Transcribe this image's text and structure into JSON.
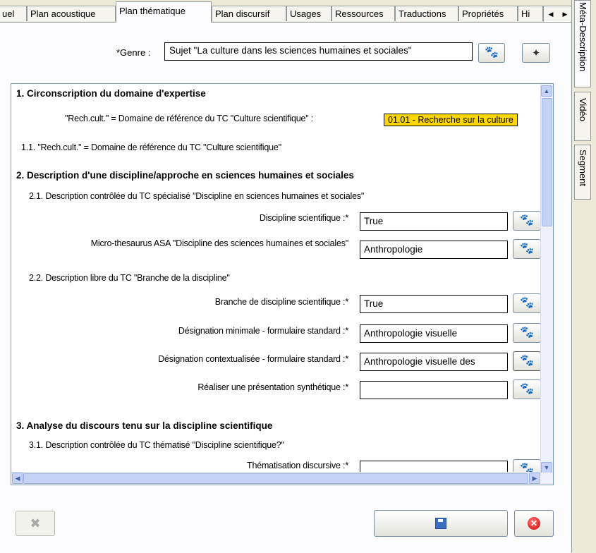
{
  "tabs": [
    {
      "label": "uel"
    },
    {
      "label": "Plan acoustique"
    },
    {
      "label": "Plan thématique",
      "active": true
    },
    {
      "label": "Plan discursif"
    },
    {
      "label": "Usages"
    },
    {
      "label": "Ressources"
    },
    {
      "label": "Traductions"
    },
    {
      "label": "Propriétés"
    },
    {
      "label": "Hi"
    }
  ],
  "side_tabs": [
    "Méta-Description",
    "Vidéo",
    "Segment"
  ],
  "genre": {
    "label": "*Genre :",
    "value": "Sujet \"La culture dans les sciences humaines et sociales\"",
    "paw_icon": "green-paw-icon",
    "wand_icon": "magic-wand-icon"
  },
  "form": {
    "s1": {
      "title": "1. Circonscription du domaine d'expertise",
      "ref_label": "\"Rech.cult.\" = Domaine de référence du TC \"Culture scientifique\" :",
      "ref_tag": "01.01 - Recherche sur la culture",
      "sub": "1.1. \"Rech.cult.\" = Domaine de référence du TC \"Culture scientifique\""
    },
    "s2": {
      "title": "2. Description d'une discipline/approche en sciences humaines et sociales",
      "sub1": "2.1. Description contrôlée du TC spécialisé \"Discipline en sciences humaines et sociales\"",
      "f1_label": "Discipline scientifique :*",
      "f1_value": "True",
      "f2_label": "Micro-thesaurus ASA \"Discipline des sciences humaines et sociales\"",
      "f2_value": "Anthropologie",
      "sub2": "2.2. Description libre du TC \"Branche de la discipline\"",
      "f3_label": "Branche de discipline scientifique :*",
      "f3_value": "True",
      "f4_label": "Désignation minimale - formulaire standard :*",
      "f4_value": "Anthropologie visuelle",
      "f5_label": "Désignation contextualisée - formulaire standard :*",
      "f5_value": "Anthropologie visuelle des",
      "f6_label": "Réaliser une présentation synthétique :*",
      "f6_value": ""
    },
    "s3": {
      "title": "3. Analyse du discours tenu sur la discipline scientifique",
      "sub1": "3.1. Description contrôlée du TC thématisé \"Discipline scientifique?\"",
      "f1_label": "Thématisation discursive :*",
      "f1_value": ""
    }
  },
  "footer": {
    "disabled_icon": "delete-icon",
    "save_icon": "save-icon",
    "cancel_icon": "cancel-icon"
  },
  "colors": {
    "tag_bg": "#ffd700",
    "paw": "#e0b000",
    "paw_green": "#7bbd3a",
    "cancel": "#d10000"
  }
}
